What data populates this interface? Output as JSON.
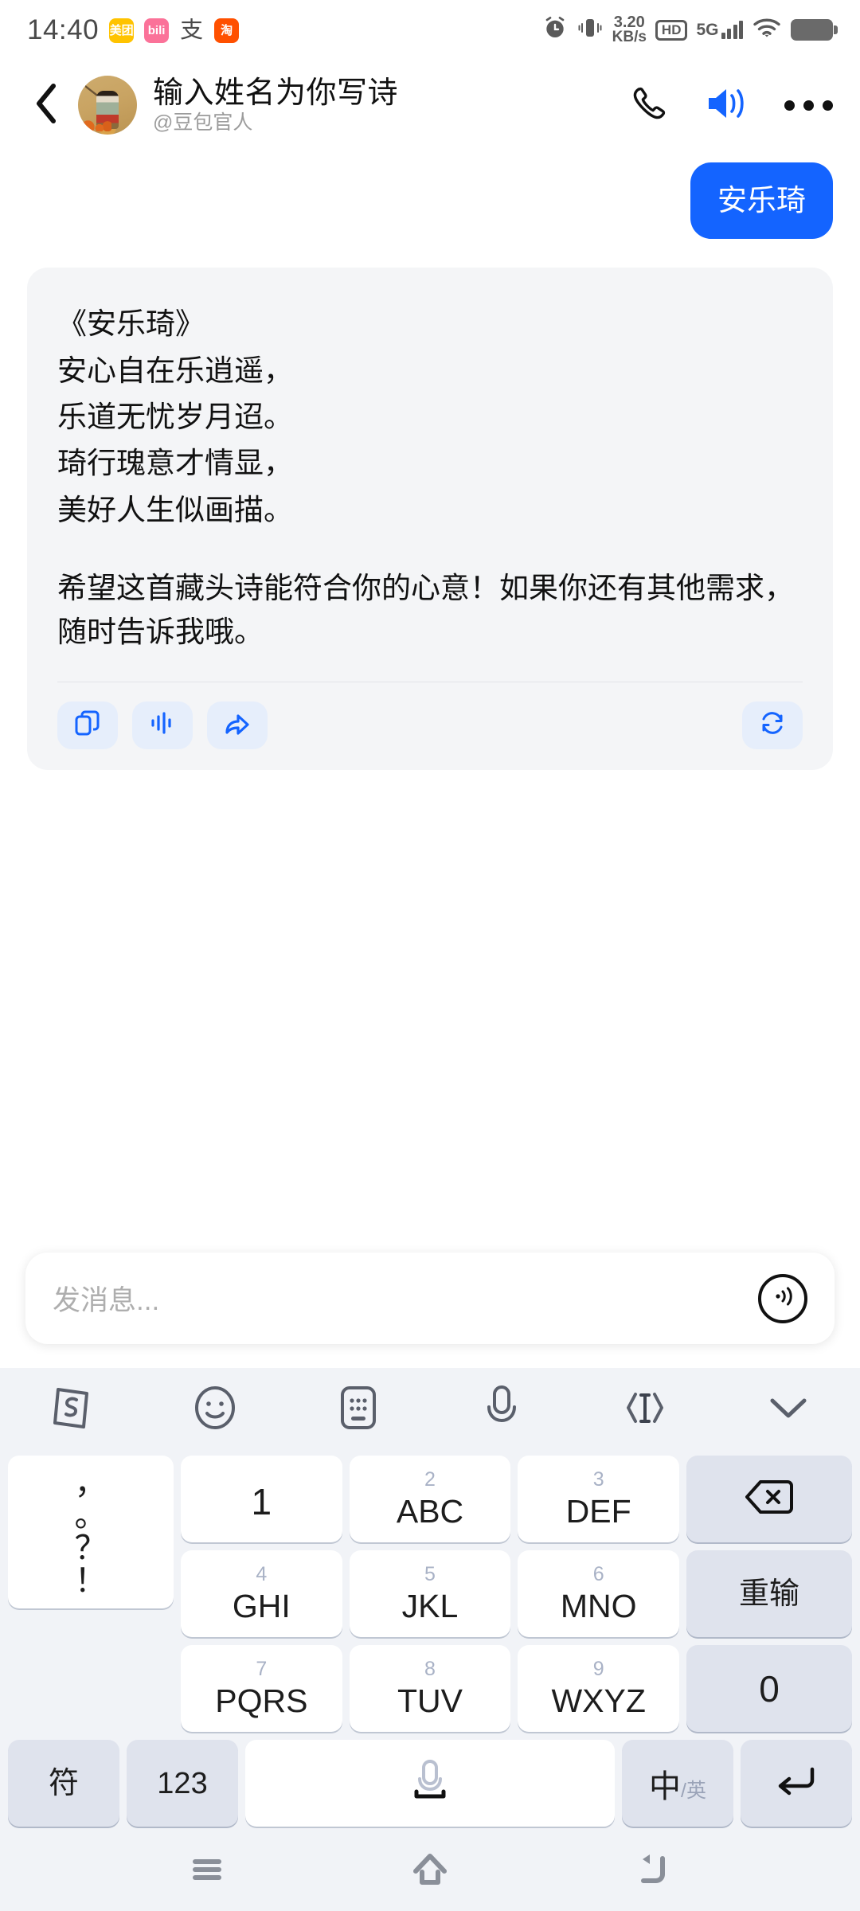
{
  "status_bar": {
    "time": "14:40",
    "app_icons": [
      {
        "name": "meituan",
        "label": "美团"
      },
      {
        "name": "bilibili",
        "label": "bili"
      },
      {
        "name": "alipay",
        "label": "支"
      },
      {
        "name": "taobao",
        "label": "淘"
      }
    ],
    "network_speed_value": "3.20",
    "network_speed_unit": "KB/s",
    "hd_label": "HD",
    "network_type": "5G",
    "signal_bars": 4,
    "icons": [
      "alarm-icon",
      "vibrate-icon",
      "hd-icon",
      "signal-icon",
      "wifi-icon",
      "battery-icon"
    ]
  },
  "header": {
    "back_icon": "chevron-left-icon",
    "title": "输入姓名为你写诗",
    "subtitle": "@豆包官人",
    "phone_icon": "phone-icon",
    "speaker_icon": "speaker-icon",
    "more_icon": "more-dots-icon",
    "speaker_color": "#1464ff"
  },
  "chat": {
    "user_message": "安乐琦",
    "user_bubble_color": "#1464ff",
    "ai_bubble_color": "#f4f5f7",
    "ai_poem_title": "《安乐琦》",
    "ai_poem_lines": [
      "安心自在乐逍遥，",
      "乐道无忧岁月迢。",
      "琦行瑰意才情显，",
      "美好人生似画描。"
    ],
    "ai_closing": "希望这首藏头诗能符合你的心意！如果你还有其他需求，随时告诉我哦。",
    "actions": [
      {
        "name": "copy-button",
        "icon": "copy-icon"
      },
      {
        "name": "read-aloud-button",
        "icon": "waveform-icon"
      },
      {
        "name": "share-button",
        "icon": "share-arrow-icon"
      },
      {
        "name": "regenerate-button",
        "icon": "refresh-icon"
      }
    ],
    "action_icon_color": "#1464ff",
    "action_bg_color": "#e6eefb"
  },
  "input_bar": {
    "placeholder": "发消息...",
    "voice_icon": "voice-wave-icon"
  },
  "keyboard": {
    "toolbar": [
      {
        "name": "sogou-logo-icon",
        "label": "S"
      },
      {
        "name": "emoji-icon",
        "label": ""
      },
      {
        "name": "keyboard-switch-icon",
        "label": ""
      },
      {
        "name": "microphone-icon",
        "label": ""
      },
      {
        "name": "text-cursor-icon",
        "label": ""
      },
      {
        "name": "collapse-keyboard-icon",
        "label": ""
      }
    ],
    "punct_col": [
      "，",
      "。",
      "？",
      "！"
    ],
    "rows": [
      [
        {
          "num": "",
          "label": "1",
          "type": "main",
          "name": "key-1"
        },
        {
          "num": "2",
          "label": "ABC",
          "type": "main",
          "name": "key-2-abc"
        },
        {
          "num": "3",
          "label": "DEF",
          "type": "main",
          "name": "key-3-def"
        },
        {
          "num": "",
          "label": "",
          "type": "fn",
          "name": "key-backspace",
          "icon": "backspace-icon"
        }
      ],
      [
        {
          "num": "4",
          "label": "GHI",
          "type": "main",
          "name": "key-4-ghi"
        },
        {
          "num": "5",
          "label": "JKL",
          "type": "main",
          "name": "key-5-jkl"
        },
        {
          "num": "6",
          "label": "MNO",
          "type": "main",
          "name": "key-6-mno"
        },
        {
          "num": "",
          "label": "重输",
          "type": "fn",
          "name": "key-retype"
        }
      ],
      [
        {
          "num": "7",
          "label": "PQRS",
          "type": "main",
          "name": "key-7-pqrs"
        },
        {
          "num": "8",
          "label": "TUV",
          "type": "main",
          "name": "key-8-tuv"
        },
        {
          "num": "9",
          "label": "WXYZ",
          "type": "main",
          "name": "key-9-wxyz"
        },
        {
          "num": "",
          "label": "0",
          "type": "fn",
          "name": "key-0"
        }
      ]
    ],
    "bottom_row": {
      "symbol": "符",
      "numbers": "123",
      "space_icon": "microphone-space-icon",
      "lang_primary": "中",
      "lang_secondary": "/英",
      "enter_icon": "enter-icon"
    }
  },
  "nav_bar": {
    "recents_icon": "recents-menu-icon",
    "home_icon": "home-icon",
    "back_icon": "back-arrow-icon"
  }
}
